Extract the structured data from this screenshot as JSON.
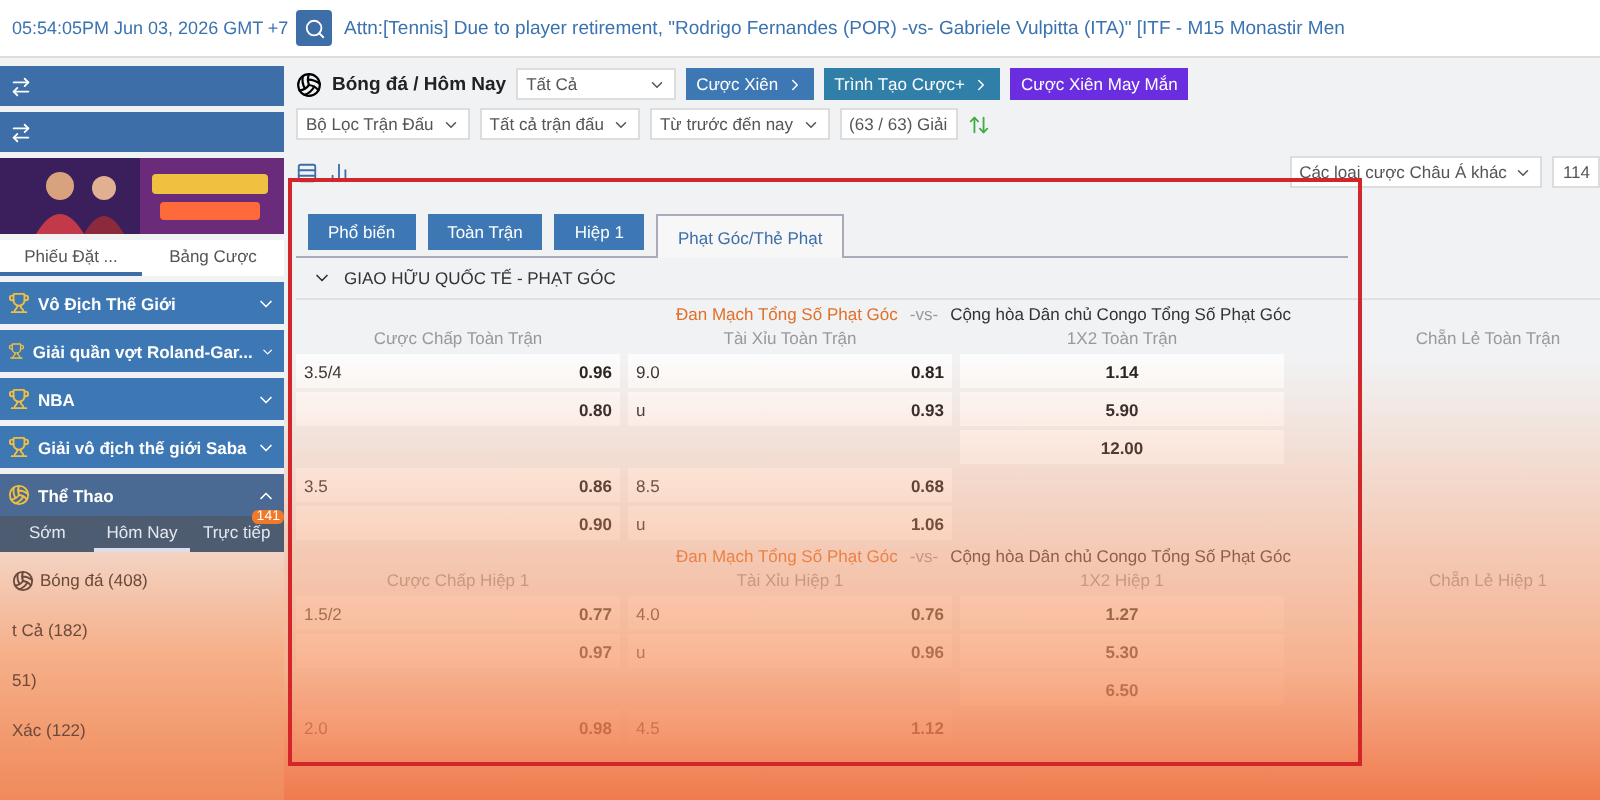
{
  "top_bar": {
    "time": "05:54:05PM Jun 03, 2026 GMT +7",
    "announcement": "Attn:[Tennis] Due to player retirement, \"Rodrigo Fernandes (POR) -vs- Gabriele Vulpitta (ITA)\" [ITF - M15 Monastir Men"
  },
  "sidebar": {
    "tabs": [
      {
        "label": "Phiếu Đặt ...",
        "selected": true
      },
      {
        "label": "Bảng Cược",
        "selected": false
      }
    ],
    "leagues": [
      {
        "label": "Vô Địch Thế Giới",
        "expanded": false
      },
      {
        "label": "Giải quần vợt Roland-Gar...",
        "expanded": false
      },
      {
        "label": "NBA",
        "expanded": false
      },
      {
        "label": "Giải vô địch thế giới Saba",
        "expanded": false
      },
      {
        "label": "Thể Thao",
        "expanded": true
      }
    ],
    "sport_tabs": [
      {
        "label": "Sớm",
        "selected": false
      },
      {
        "label": "Hôm Nay",
        "selected": true
      },
      {
        "label": "Trực tiếp",
        "selected": false,
        "badge": "141"
      }
    ],
    "sports": [
      {
        "name": "Bóng đá",
        "count": "(408)"
      },
      {
        "name": "t Cả",
        "count": "(182)"
      },
      {
        "count": "51)"
      },
      {
        "name": "Xác",
        "count": "(122)"
      }
    ]
  },
  "toolbar": {
    "breadcrumb": "Bóng đá / Hôm Nay",
    "select": "Tất Cả",
    "buttons": [
      {
        "label": "Cược Xiên",
        "kind": "blue"
      },
      {
        "label": "Trình Tạo Cược+",
        "kind": "teal"
      },
      {
        "label": "Cược Xiên May Mắn",
        "kind": "purple"
      }
    ],
    "filters": [
      "Bộ Lọc Trận Đấu",
      "Tất cả trận đấu",
      "Từ trước đến nay"
    ],
    "league_count": "(63 / 63) Giải",
    "market_select": "Các loại cược Châu Á khác",
    "count": "114"
  },
  "market_tabs": [
    {
      "label": "Phổ biến",
      "selected": false
    },
    {
      "label": "Toàn Trận",
      "selected": false
    },
    {
      "label": "Hiệp 1",
      "selected": false
    },
    {
      "label": "Phạt Góc/Thẻ Phạt",
      "selected": true
    }
  ],
  "league": "GIAO HỮU QUỐC TẾ - PHẠT GÓC",
  "sections": [
    {
      "home": "Đan Mạch Tổng Số Phạt Góc",
      "vs": "-vs-",
      "away": "Cộng hòa Dân chủ Congo Tổng Số Phạt Góc",
      "columns": [
        "Cược Chấp Toàn Trận",
        "Tài Xỉu Toàn Trận",
        "1X2 Toàn Trận",
        "Chẵn Lẻ Toàn Trận"
      ],
      "rows": [
        [
          {
            "line": "3.5/4",
            "odds": "0.96"
          },
          {
            "line": "9.0",
            "odds": "0.81"
          },
          {
            "odds": "1.14"
          }
        ],
        [
          {
            "odds": "0.80"
          },
          {
            "line": "u",
            "odds": "0.93"
          },
          {
            "odds": "5.90"
          }
        ],
        [
          null,
          null,
          {
            "odds": "12.00"
          }
        ],
        [
          {
            "line": "3.5",
            "odds": "0.86"
          },
          {
            "line": "8.5",
            "odds": "0.68"
          },
          null
        ],
        [
          {
            "odds": "0.90"
          },
          {
            "line": "u",
            "odds": "1.06"
          },
          null
        ]
      ]
    },
    {
      "home": "Đan Mạch Tổng Số Phạt Góc",
      "vs": "-vs-",
      "away": "Cộng hòa Dân chủ Congo Tổng Số Phạt Góc",
      "columns": [
        "Cược Chấp Hiệp 1",
        "Tài Xỉu Hiệp 1",
        "1X2 Hiệp 1",
        "Chẵn Lẻ Hiệp 1"
      ],
      "rows": [
        [
          {
            "line": "1.5/2",
            "odds": "0.77"
          },
          {
            "line": "4.0",
            "odds": "0.76"
          },
          {
            "odds": "1.27"
          }
        ],
        [
          {
            "odds": "0.97"
          },
          {
            "line": "u",
            "odds": "0.96"
          },
          {
            "odds": "5.30"
          }
        ],
        [
          null,
          null,
          {
            "odds": "6.50"
          }
        ],
        [
          {
            "line": "2.0",
            "odds": "0.98"
          },
          {
            "line": "4.5",
            "odds": "1.12"
          },
          null
        ]
      ]
    }
  ]
}
